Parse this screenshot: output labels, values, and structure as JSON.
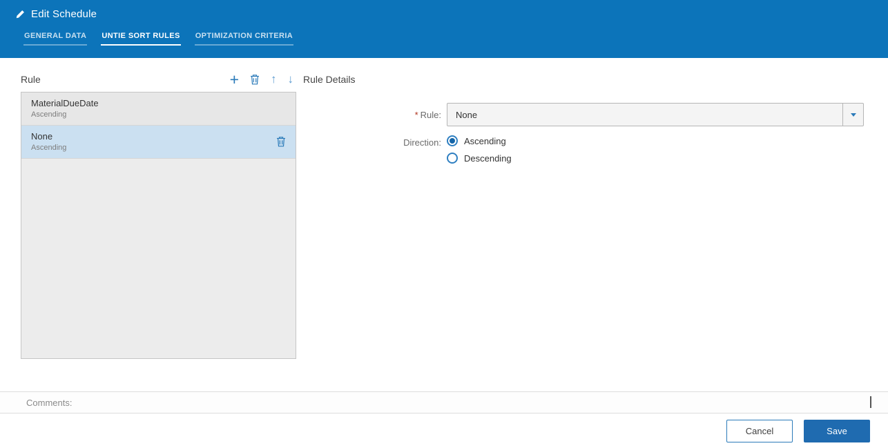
{
  "header": {
    "title": "Edit Schedule",
    "tabs": [
      {
        "label": "GENERAL DATA"
      },
      {
        "label": "UNTIE SORT RULES"
      },
      {
        "label": "OPTIMIZATION CRITERIA"
      }
    ],
    "active_tab": "UNTIE SORT RULES"
  },
  "rule_list": {
    "title": "Rule",
    "items": [
      {
        "name": "MaterialDueDate",
        "direction": "Ascending",
        "selected": false
      },
      {
        "name": "None",
        "direction": "Ascending",
        "selected": true
      }
    ]
  },
  "rule_details": {
    "title": "Rule Details",
    "required_marker": "*",
    "rule_label": "Rule:",
    "rule_value": "None",
    "direction_label": "Direction:",
    "direction_options": [
      {
        "label": "Ascending",
        "selected": true
      },
      {
        "label": "Descending",
        "selected": false
      }
    ]
  },
  "comments": {
    "label": "Comments:"
  },
  "footer": {
    "cancel_label": "Cancel",
    "save_label": "Save"
  },
  "colors": {
    "header_blue": "#0c74ba",
    "accent_blue": "#2a7ab9",
    "save_button": "#1f6bb0",
    "selected_row": "#cbe0f1"
  }
}
